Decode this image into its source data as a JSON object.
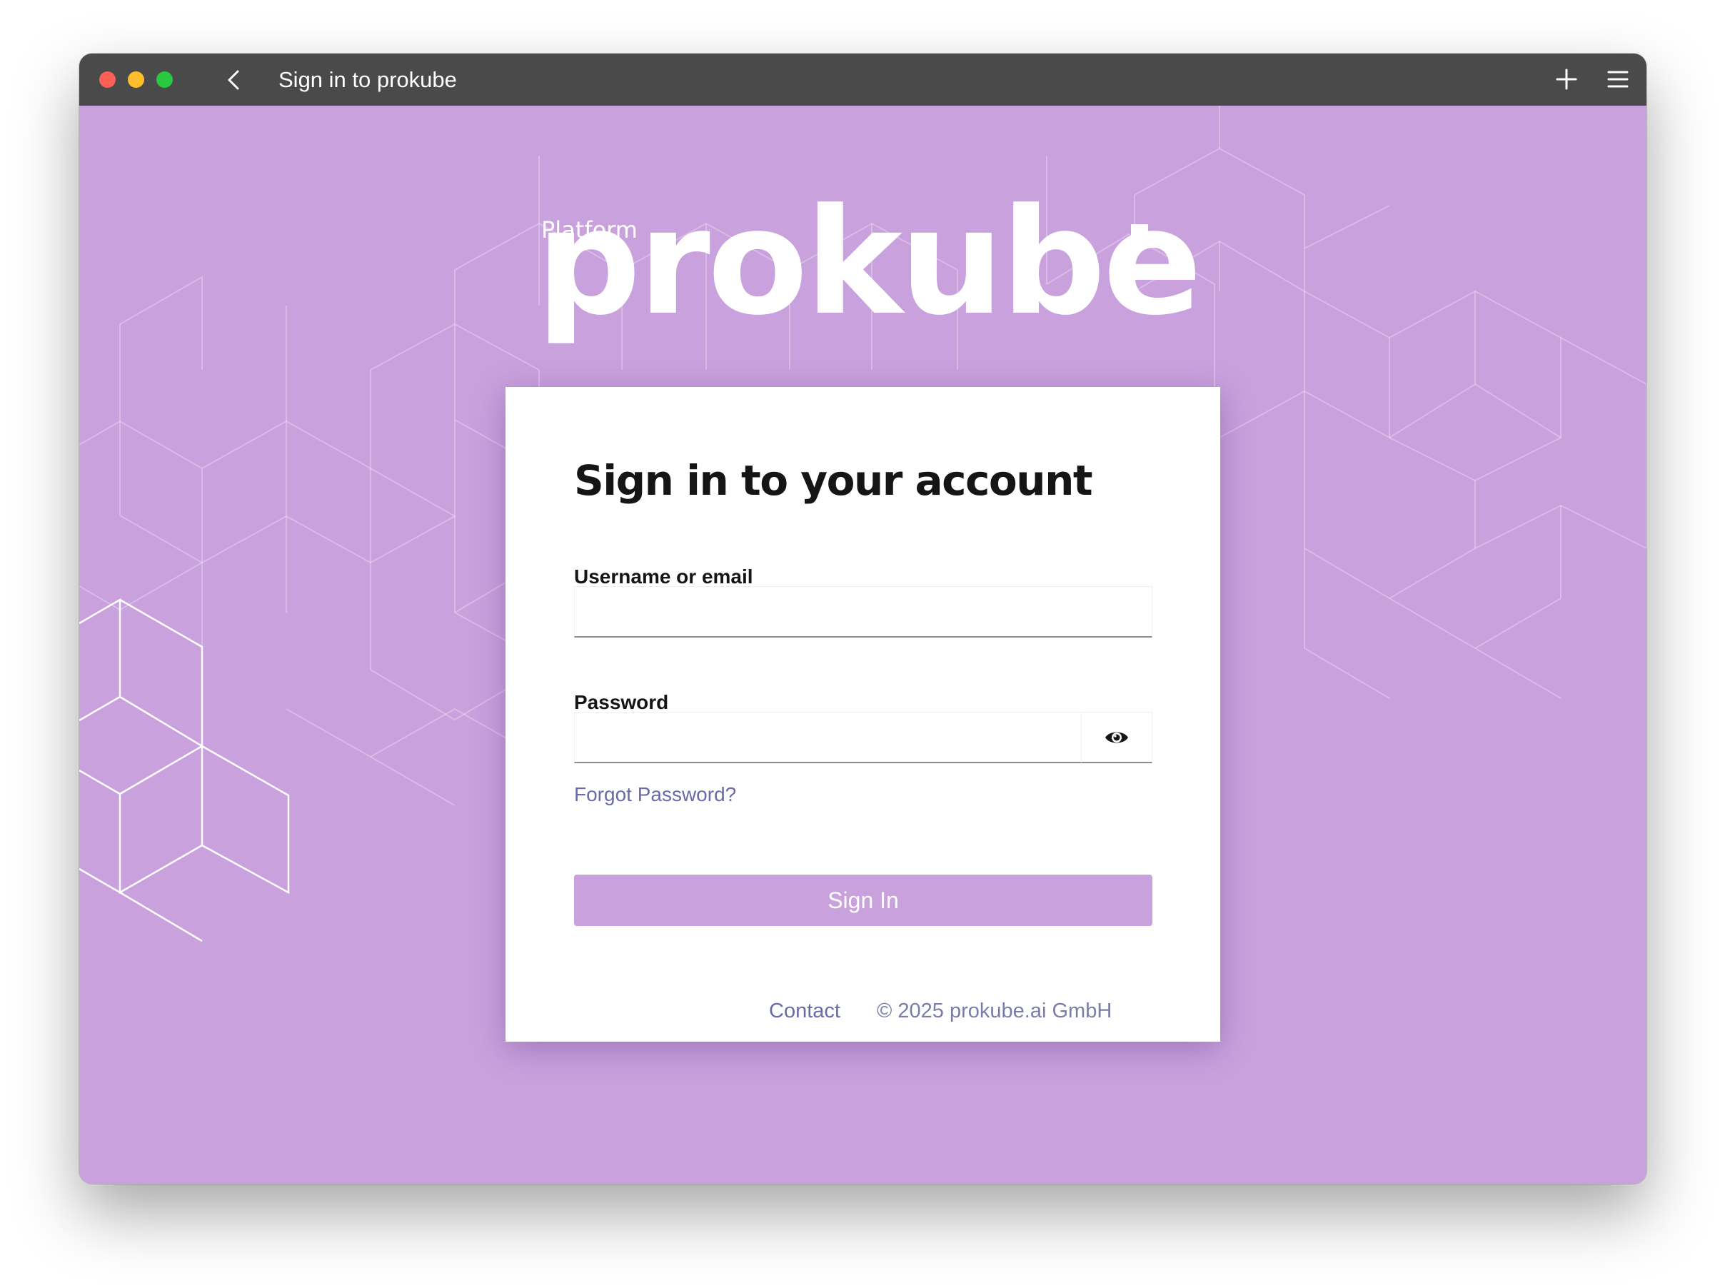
{
  "window": {
    "title": "Sign in to prokube"
  },
  "icons": {
    "back": "chevron-left-icon",
    "new_tab": "plus-icon",
    "menu": "hamburger-icon",
    "password_toggle": "eye-icon"
  },
  "branding": {
    "platform_label": "Platform",
    "wordmark": "prokube"
  },
  "login": {
    "heading": "Sign in to your account",
    "username_label": "Username or email",
    "username_value": "",
    "password_label": "Password",
    "password_value": "",
    "forgot_link": "Forgot Password?",
    "submit_label": "Sign In"
  },
  "footer": {
    "contact_link": "Contact",
    "copyright": "© 2025 prokube.ai GmbH"
  },
  "colors": {
    "background": "#c9a1dd",
    "titlebar": "#4a4a4a",
    "link": "#6a6aa8",
    "button": "#c9a1dd"
  }
}
